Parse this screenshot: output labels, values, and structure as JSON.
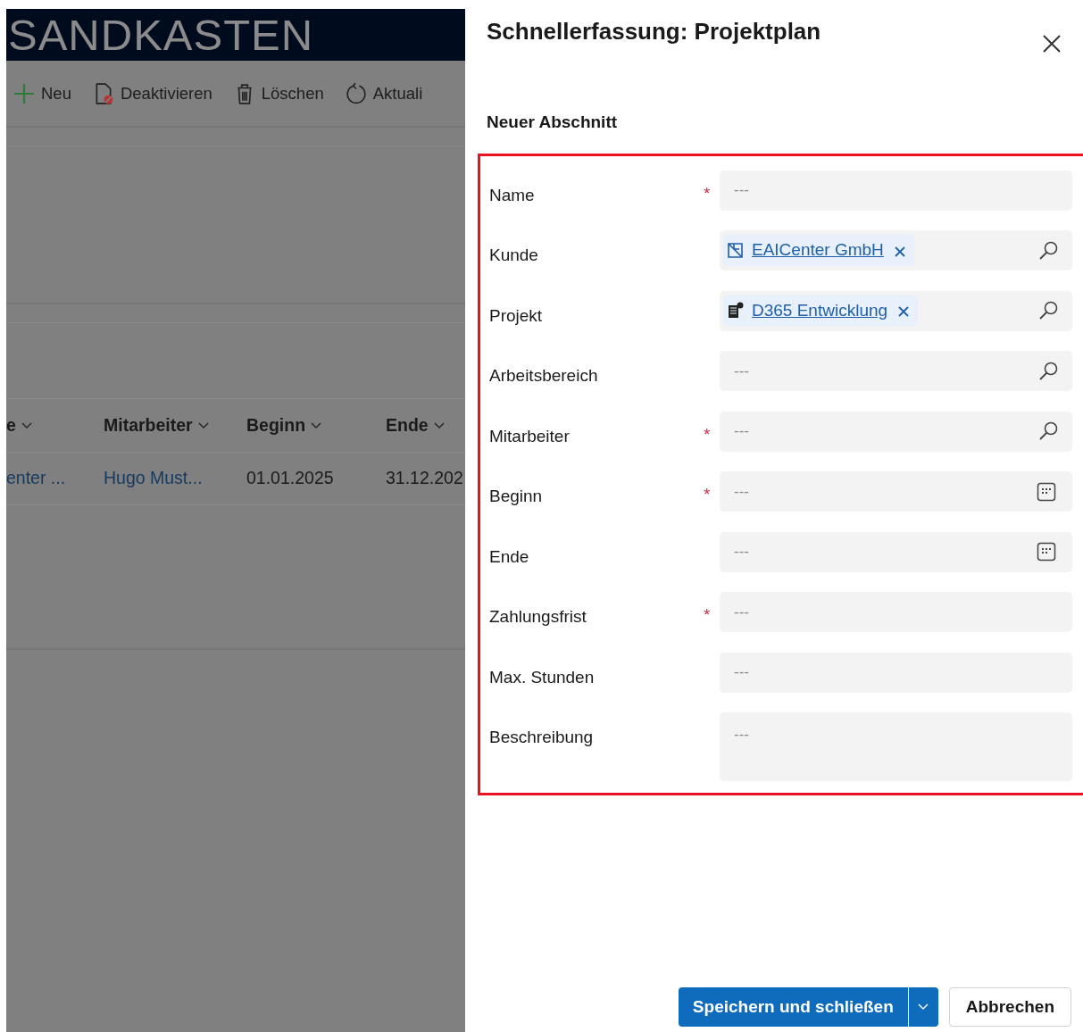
{
  "header": {
    "title": "SANDKASTEN"
  },
  "commands": [
    {
      "label": "Neu",
      "kind": "add"
    },
    {
      "label": "Deaktivieren",
      "kind": "deactivate"
    },
    {
      "label": "Löschen",
      "kind": "delete"
    },
    {
      "label": "Aktuali",
      "kind": "refresh"
    }
  ],
  "grid": {
    "columns": [
      {
        "label": "e"
      },
      {
        "label": "Mitarbeiter"
      },
      {
        "label": "Beginn"
      },
      {
        "label": "Ende"
      }
    ],
    "rows": [
      {
        "cells": [
          {
            "text": "enter ...",
            "kind": "link"
          },
          {
            "text": "Hugo Must...",
            "kind": "link"
          },
          {
            "text": "01.01.2025",
            "kind": "text"
          },
          {
            "text": "31.12.202",
            "kind": "text"
          }
        ]
      }
    ]
  },
  "dialog": {
    "title": "Schnellerfassung: Projektplan",
    "section": "Neuer Abschnitt",
    "highlighted": true,
    "required_mark": "*",
    "fields": [
      {
        "label": "Name",
        "required": true,
        "kind": "text",
        "placeholder": "---"
      },
      {
        "label": "Kunde",
        "required": false,
        "kind": "lookup",
        "value": {
          "text": "EAICenter GmbH"
        }
      },
      {
        "label": "Projekt",
        "required": false,
        "kind": "lookup",
        "value": {
          "text": "D365 Entwicklung"
        }
      },
      {
        "label": "Arbeitsbereich",
        "required": false,
        "kind": "lookup",
        "placeholder": "---"
      },
      {
        "label": "Mitarbeiter",
        "required": true,
        "kind": "lookup",
        "placeholder": "---"
      },
      {
        "label": "Beginn",
        "required": true,
        "kind": "date",
        "placeholder": "---"
      },
      {
        "label": "Ende",
        "required": false,
        "kind": "date",
        "placeholder": "---"
      },
      {
        "label": "Zahlungsfrist",
        "required": true,
        "kind": "text",
        "placeholder": "---"
      },
      {
        "label": "Max. Stunden",
        "required": false,
        "kind": "text",
        "placeholder": "---"
      },
      {
        "label": "Beschreibung",
        "required": false,
        "kind": "multiline",
        "placeholder": "---"
      }
    ],
    "buttons": [
      {
        "label": "Speichern und schließen",
        "kind": "primary"
      },
      {
        "label": "Abbrechen",
        "kind": "secondary"
      }
    ]
  }
}
